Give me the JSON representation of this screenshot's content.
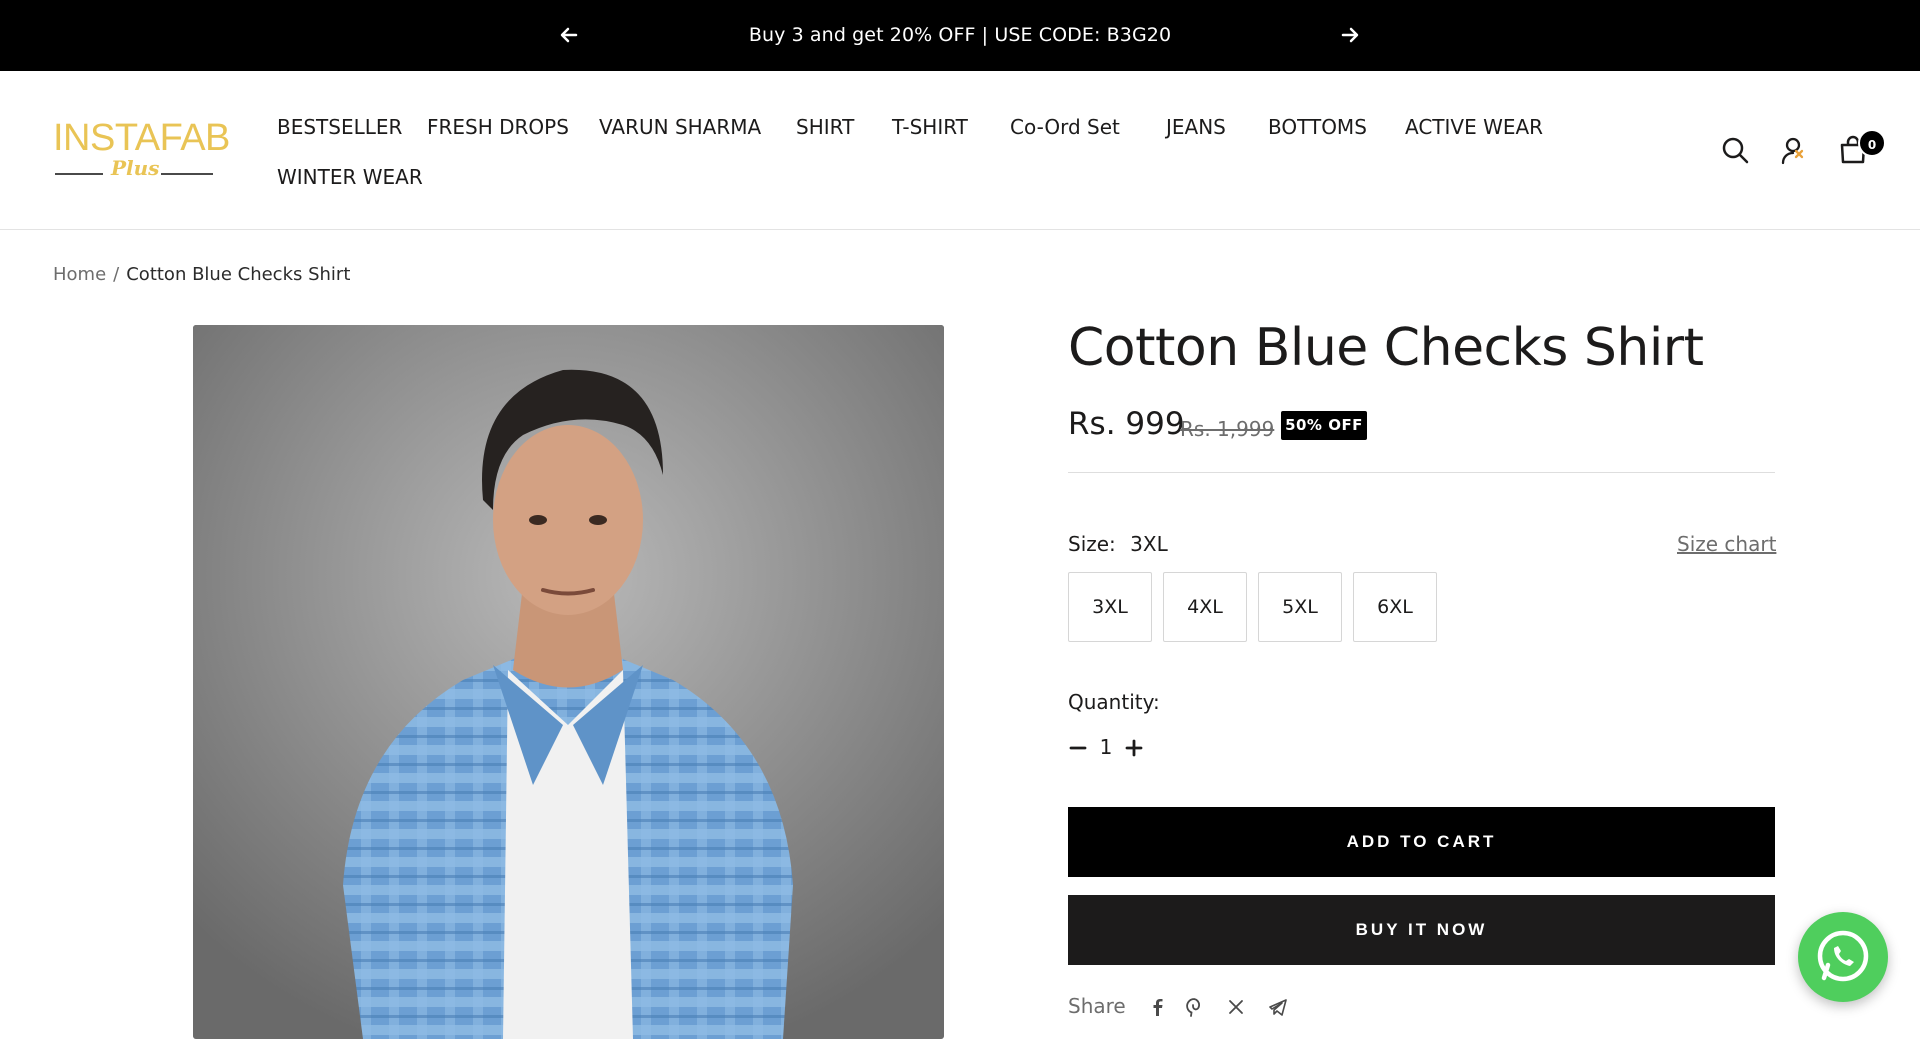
{
  "announcement": {
    "text": "Buy 3 and get 20% OFF | USE CODE: B3G20",
    "prev_icon": "arrow-left-icon",
    "next_icon": "arrow-right-icon"
  },
  "logo": {
    "brand": "INSTAFAB",
    "sub": "Plus",
    "colors": {
      "gold": "#e9c455",
      "line": "#4a4a4a"
    }
  },
  "nav": {
    "items": [
      "BESTSELLER",
      "FRESH DROPS",
      "VARUN SHARMA",
      "SHIRT",
      "T-SHIRT",
      "Co-Ord Set",
      "JEANS",
      "BOTTOMS",
      "ACTIVE WEAR",
      "WINTER WEAR"
    ]
  },
  "header_icons": {
    "search": "search-icon",
    "account": "account-icon",
    "cart": "cart-icon",
    "cart_count": "0"
  },
  "breadcrumb": {
    "home": "Home",
    "separator": "/",
    "current": "Cotton Blue Checks Shirt"
  },
  "product": {
    "title": "Cotton Blue Checks Shirt",
    "price": "Rs. 999",
    "compare_price": "Rs. 1,999",
    "discount_badge": "50% OFF",
    "size_label": "Size:",
    "size_selected": "3XL",
    "size_chart_link": "Size chart",
    "sizes": [
      "3XL",
      "4XL",
      "5XL",
      "6XL"
    ],
    "quantity_label": "Quantity:",
    "quantity": "1",
    "add_to_cart": "ADD TO CART",
    "buy_now": "BUY IT NOW",
    "share_label": "Share",
    "share_icons": [
      "facebook-icon",
      "pinterest-icon",
      "x-icon",
      "telegram-icon"
    ]
  },
  "colors": {
    "announcement_bg": "#000000",
    "button_bg": "#000000",
    "whatsapp": "#4fce5d"
  },
  "floating": {
    "whatsapp": "whatsapp-icon"
  }
}
